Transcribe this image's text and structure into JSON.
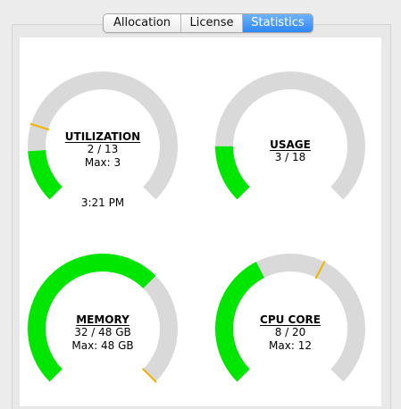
{
  "tabs": [
    {
      "label": "Allocation",
      "selected": false
    },
    {
      "label": "License",
      "selected": false
    },
    {
      "label": "Statistics",
      "selected": true
    }
  ],
  "colors": {
    "track": "#d9d9d9",
    "fill": "#00e600",
    "marker": "#f2b300",
    "selected_tab": "#3d8ff8",
    "panel": "#ffffff"
  },
  "gauges": {
    "utilization": {
      "title": "UTILIZATION",
      "value_text": "2 / 13",
      "max_text": "Max: 3",
      "time": "3:21 PM",
      "value": 2,
      "total": 13,
      "max_value": 3,
      "fill_fraction": 0.153,
      "marker_fraction": 0.231
    },
    "usage": {
      "title": "USAGE",
      "value_text": "3 / 18",
      "value": 3,
      "total": 18,
      "fill_fraction": 0.167
    },
    "memory": {
      "title": "MEMORY",
      "value_text": "32 / 48 GB",
      "max_text": "Max: 48 GB",
      "value": 32,
      "total": 48,
      "max_value": 48,
      "fill_fraction": 0.667,
      "marker_fraction": 1.0
    },
    "cpu_core": {
      "title": "CPU CORE",
      "value_text": "8 / 20",
      "max_text": "Max: 12",
      "value": 8,
      "total": 20,
      "max_value": 12,
      "fill_fraction": 0.4,
      "marker_fraction": 0.6
    }
  }
}
